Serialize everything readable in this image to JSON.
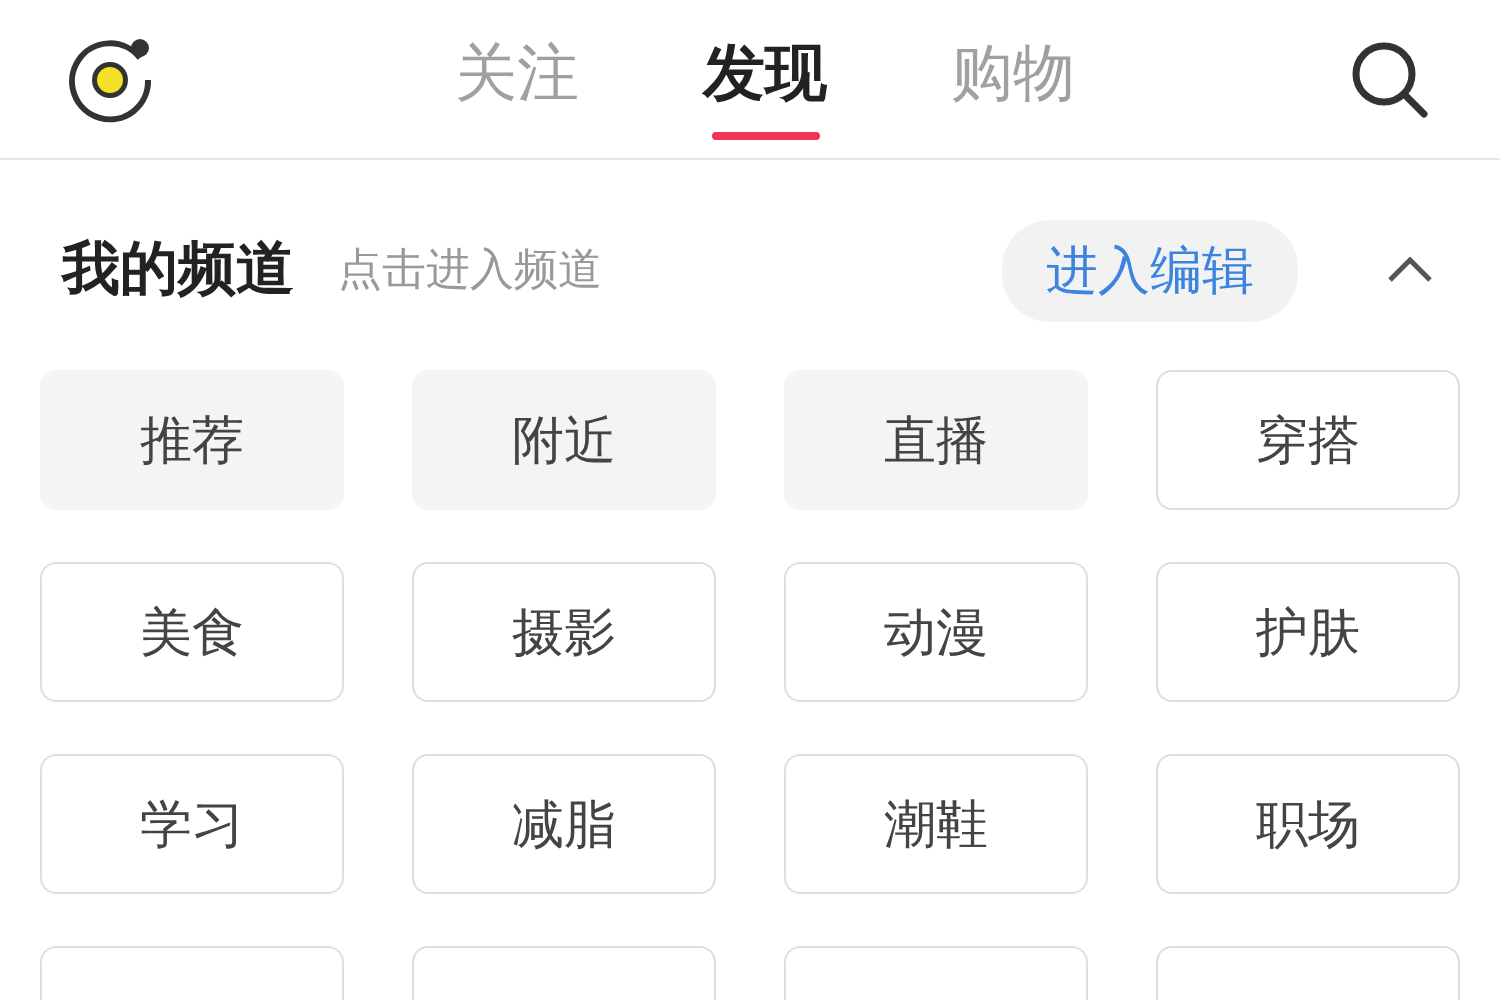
{
  "tabs": [
    {
      "label": "关注",
      "selected": false
    },
    {
      "label": "发现",
      "selected": true
    },
    {
      "label": "购物",
      "selected": false
    }
  ],
  "section": {
    "title": "我的频道",
    "hint": "点击进入频道",
    "edit_button": "进入编辑",
    "expanded": true
  },
  "channels": [
    {
      "label": "推荐",
      "fixed": true
    },
    {
      "label": "附近",
      "fixed": true
    },
    {
      "label": "直播",
      "fixed": true
    },
    {
      "label": "穿搭",
      "fixed": false
    },
    {
      "label": "美食",
      "fixed": false
    },
    {
      "label": "摄影",
      "fixed": false
    },
    {
      "label": "动漫",
      "fixed": false
    },
    {
      "label": "护肤",
      "fixed": false
    },
    {
      "label": "学习",
      "fixed": false
    },
    {
      "label": "减脂",
      "fixed": false
    },
    {
      "label": "潮鞋",
      "fixed": false
    },
    {
      "label": "职场",
      "fixed": false
    }
  ]
}
